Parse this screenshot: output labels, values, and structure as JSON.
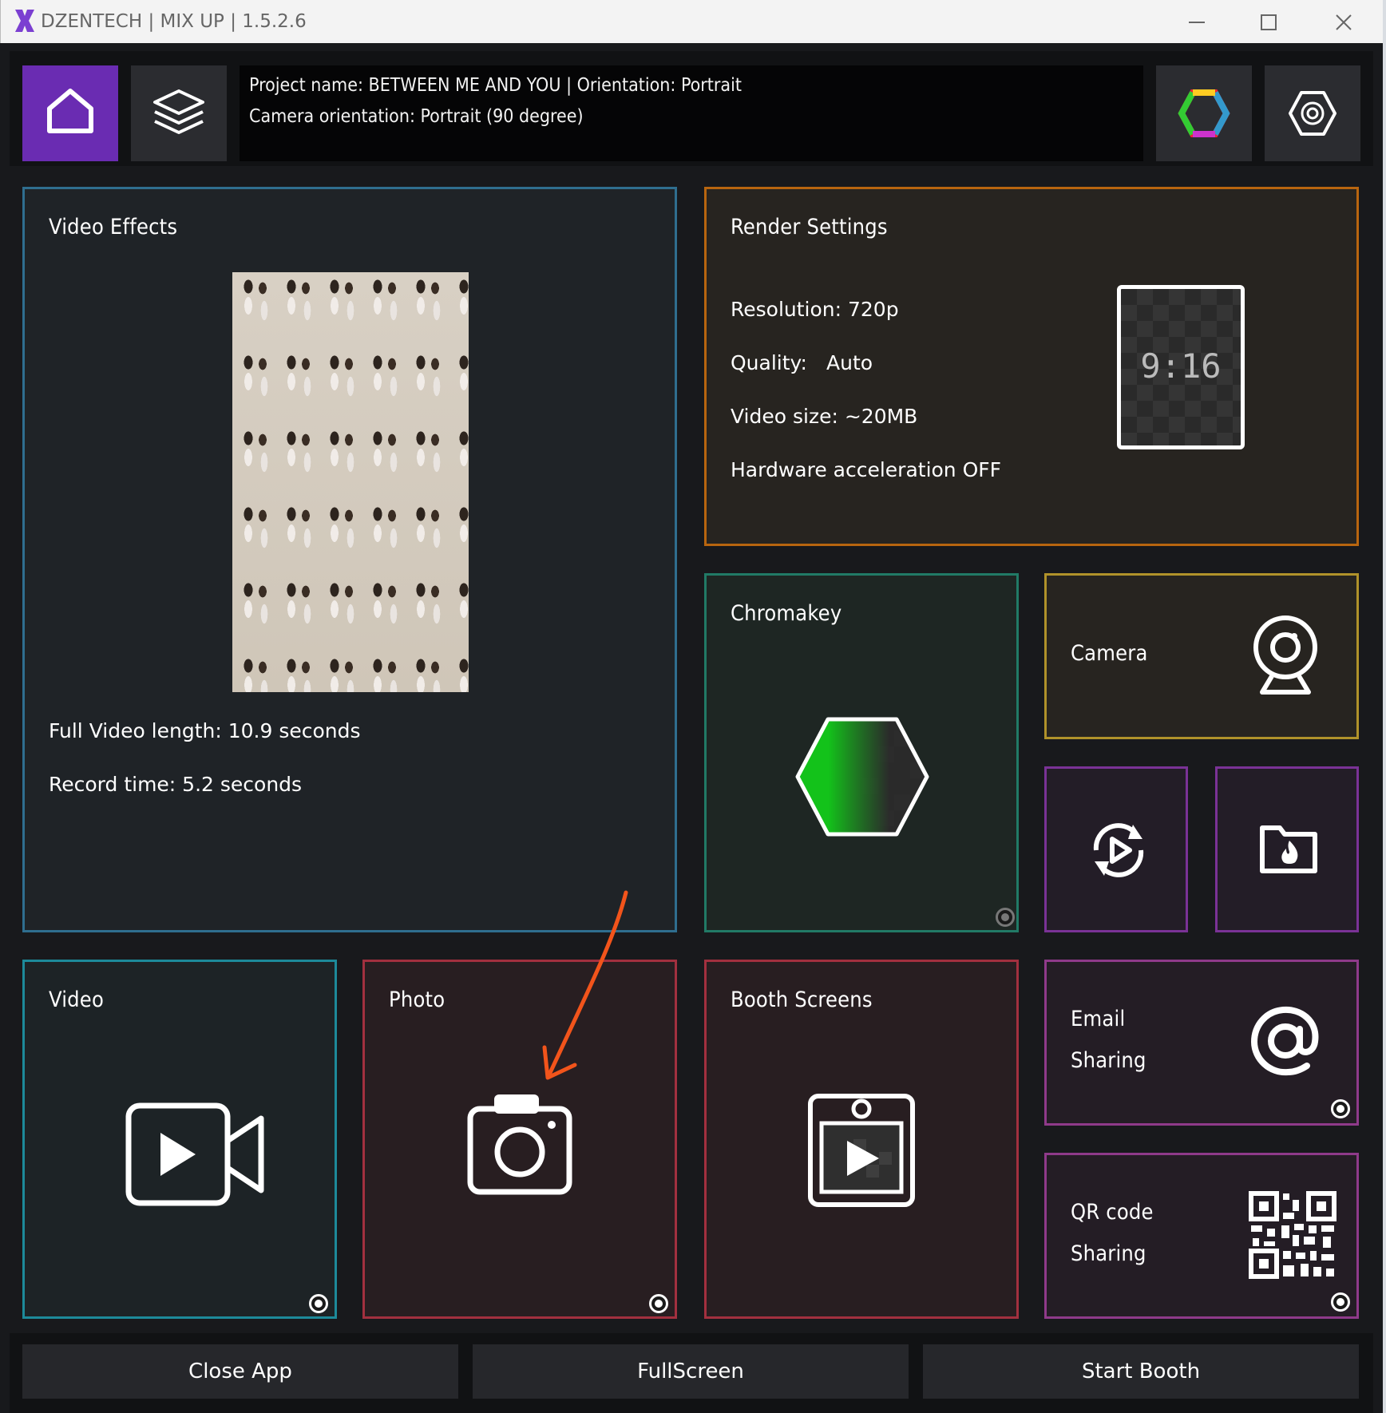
{
  "window": {
    "title": "DZENTECH | MIX UP | 1.5.2.6",
    "minimize_icon": "minimize-icon",
    "maximize_icon": "maximize-icon",
    "close_icon": "close-icon"
  },
  "toolbar": {
    "home_icon": "home-icon",
    "layers_icon": "layers-icon",
    "color_icon": "rainbow-hexagon-icon",
    "settings_icon": "gear-icon",
    "active_color": "#6a2cb2"
  },
  "info": {
    "line1": "Project name: BETWEEN ME AND YOU | Orientation: Portrait",
    "line2": "Camera orientation: Portrait (90 degree)"
  },
  "video_effects": {
    "title": "Video Effects",
    "length": "Full Video length: 10.9 seconds",
    "record": "Record time:  5.2 seconds",
    "border_color": "#2f6e8f"
  },
  "render": {
    "title": "Render Settings",
    "resolution": "Resolution: 720p",
    "quality_label": "Quality:",
    "quality_value": "Auto",
    "size": "Video size: ~20MB",
    "hwaccel": "Hardware acceleration OFF",
    "aspect": "9:16",
    "border_color": "#b8650f"
  },
  "chromakey": {
    "title": "Chromakey",
    "border_color": "#217a66"
  },
  "camera": {
    "title": "Camera",
    "border_color": "#b0922a"
  },
  "video": {
    "title": "Video",
    "border_color": "#1d8a9a"
  },
  "photo": {
    "title": "Photo",
    "border_color": "#a2303f"
  },
  "booth": {
    "title": "Booth Screens",
    "border_color": "#a2303f"
  },
  "email": {
    "line1": "Email",
    "line2": "Sharing",
    "border_color": "#8f3a8a"
  },
  "qr": {
    "line1": "QR code",
    "line2": "Sharing",
    "border_color": "#8f3a8a"
  },
  "small_tiles": {
    "replay_icon": "replay-icon",
    "folder_icon": "hot-folder-icon",
    "border_color": "#7a3296"
  },
  "bottom": {
    "close": "Close App",
    "fullscreen": "FullScreen",
    "start": "Start Booth"
  },
  "annotation": {
    "arrow_color": "#f2541b"
  }
}
